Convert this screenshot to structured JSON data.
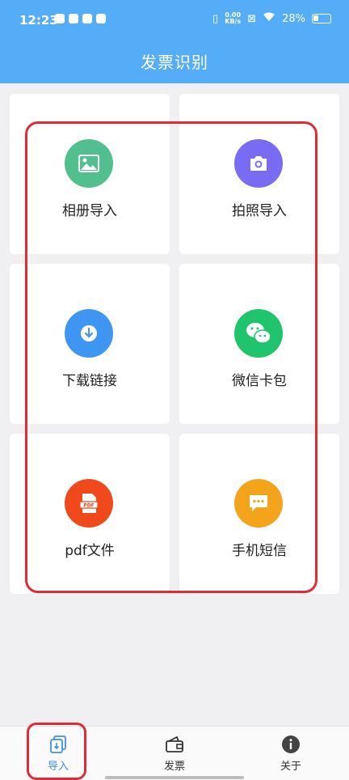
{
  "status_bar": {
    "time": "12:23",
    "net_speed_value": "0.00",
    "net_speed_unit": "KB/s",
    "battery": "28%"
  },
  "header": {
    "title": "发票识别"
  },
  "tiles": [
    {
      "label": "相册导入",
      "icon": "image-icon",
      "color": "#52c08e"
    },
    {
      "label": "拍照导入",
      "icon": "camera-icon",
      "color": "#7a6cf2"
    },
    {
      "label": "下载链接",
      "icon": "download-icon",
      "color": "#3f95f2"
    },
    {
      "label": "微信卡包",
      "icon": "wechat-icon",
      "color": "#1fc46c"
    },
    {
      "label": "pdf文件",
      "icon": "pdf-icon",
      "color": "#f0491c"
    },
    {
      "label": "手机短信",
      "icon": "message-icon",
      "color": "#f3a41b"
    }
  ],
  "bottom_nav": {
    "items": [
      {
        "label": "导入",
        "icon": "import-icon",
        "active": true
      },
      {
        "label": "发票",
        "icon": "wallet-icon",
        "active": false
      },
      {
        "label": "关于",
        "icon": "info-icon",
        "active": false
      }
    ]
  },
  "colors": {
    "header_bg": "#56adf7",
    "highlight": "#e12a35",
    "active_tab": "#3f8fe6"
  }
}
